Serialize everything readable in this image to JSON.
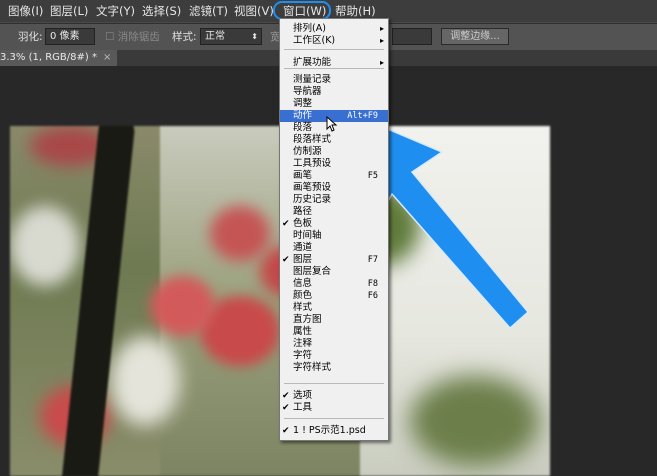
{
  "menubar": {
    "items": [
      "图像(I)",
      "图层(L)",
      "文字(Y)",
      "选择(S)",
      "滤镜(T)",
      "视图(V)",
      "窗口(W)",
      "帮助(H)"
    ]
  },
  "options": {
    "feather_label": "羽化:",
    "feather_value": "0 像素",
    "antialias_label": "消除锯齿",
    "style_label": "样式:",
    "style_value": "正常",
    "width_label": "宽",
    "refine_edge_button": "调整边缘..."
  },
  "document_tab": {
    "title": "3.3% (1, RGB/8#) *",
    "close": "×"
  },
  "window_menu": {
    "items": [
      {
        "label": "排列(A)",
        "arrow": "▸"
      },
      {
        "label": "工作区(K)",
        "arrow": "▸"
      },
      {
        "label": "扩展功能",
        "arrow": "▸"
      },
      {
        "label": "测量记录"
      },
      {
        "label": "导航器"
      },
      {
        "label": "调整"
      },
      {
        "label": "动作",
        "shortcut": "Alt+F9",
        "active": true
      },
      {
        "label": "段落"
      },
      {
        "label": "段落样式"
      },
      {
        "label": "仿制源"
      },
      {
        "label": "工具预设"
      },
      {
        "label": "画笔",
        "shortcut": "F5"
      },
      {
        "label": "画笔预设"
      },
      {
        "label": "历史记录"
      },
      {
        "label": "路径"
      },
      {
        "label": "色板",
        "check": "✔"
      },
      {
        "label": "时间轴"
      },
      {
        "label": "通道"
      },
      {
        "label": "图层",
        "shortcut": "F7",
        "check": "✔"
      },
      {
        "label": "图层复合"
      },
      {
        "label": "信息",
        "shortcut": "F8"
      },
      {
        "label": "颜色",
        "shortcut": "F6"
      },
      {
        "label": "样式"
      },
      {
        "label": "直方图"
      },
      {
        "label": "属性"
      },
      {
        "label": "注释"
      },
      {
        "label": "字符"
      },
      {
        "label": "字符样式"
      },
      {
        "label": "选项",
        "check": "✔"
      },
      {
        "label": "工具",
        "check": "✔"
      },
      {
        "label": "1 ! PS示范1.psd",
        "check": "✔"
      }
    ]
  },
  "colors": {
    "accent_arrow": "#1e8ef0",
    "menu_highlight": "#3a6fd2"
  }
}
